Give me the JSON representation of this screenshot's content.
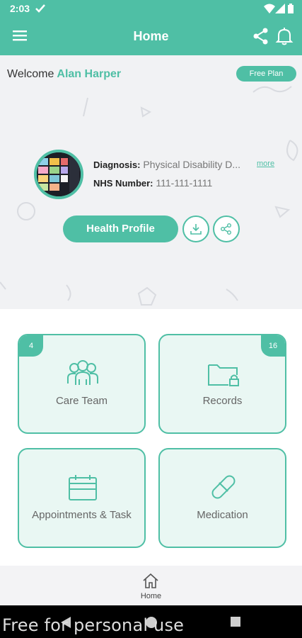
{
  "status_bar": {
    "time": "2:03"
  },
  "app_bar": {
    "title": "Home"
  },
  "welcome": {
    "prefix": "Welcome",
    "name": "Alan Harper",
    "plan_badge": "Free Plan"
  },
  "profile": {
    "diagnosis_label": "Diagnosis:",
    "diagnosis_value": "Physical Disability D...",
    "nhs_label": "NHS Number:",
    "nhs_value": "111-111-1111",
    "more_link": "more",
    "health_profile_button": "Health Profile"
  },
  "cards": [
    {
      "label": "Care Team",
      "count": "4",
      "icon": "care-team-icon"
    },
    {
      "label": "Records",
      "count": "16",
      "icon": "folder-lock-icon"
    },
    {
      "label": "Appointments & Task",
      "icon": "calendar-icon"
    },
    {
      "label": "Medication",
      "icon": "pill-icon"
    }
  ],
  "bottom_nav": {
    "home_label": "Home"
  },
  "system_nav": {
    "watermark": "Free for personal use"
  },
  "colors": {
    "accent": "#4fbfa5",
    "card_fill": "#e9f7f3",
    "background": "#f2f3f5"
  }
}
